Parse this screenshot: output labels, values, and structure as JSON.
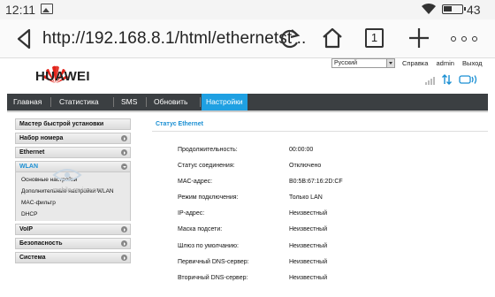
{
  "status_bar": {
    "time": "12:11",
    "battery_level": "43"
  },
  "browser": {
    "url": "http://192.168.8.1/html/ethernetst ..",
    "tab_count": "1"
  },
  "header": {
    "brand": "HUAWEI",
    "language": "Русский",
    "help_link": "Справка",
    "user_link": "admin",
    "logout_link": "Выход"
  },
  "nav": {
    "items": [
      {
        "label": "Главная"
      },
      {
        "label": "Статистика"
      },
      {
        "label": "SMS"
      },
      {
        "label": "Обновить"
      },
      {
        "label": "Настройки"
      }
    ]
  },
  "sidebar": {
    "quick_setup": "Мастер быстрой установки",
    "dialup": "Набор номера",
    "ethernet": "Ethernet",
    "wlan": "WLAN",
    "wlan_sub": [
      "Основные настройки",
      "Дополнительные настройки WLAN",
      "MAC-фильтр",
      "DHCP"
    ],
    "voip": "VoIP",
    "security": "Безопасность",
    "system": "Система"
  },
  "watermark_text": "mobile-review.com",
  "content": {
    "title": "Статус Ethernet",
    "rows": [
      {
        "label": "Продолжительность:",
        "value": "00:00:00"
      },
      {
        "label": "Статус соединения:",
        "value": "Отключено"
      },
      {
        "label": "MAC-адрес:",
        "value": "B0:5B:67:16:2D:CF"
      },
      {
        "label": "Режим подключения:",
        "value": "Только LAN"
      },
      {
        "label": "IP-адрес:",
        "value": "Неизвестный"
      },
      {
        "label": "Маска подсети:",
        "value": "Неизвестный"
      },
      {
        "label": "Шлюз по умолчанию:",
        "value": "Неизвестный"
      },
      {
        "label": "Первичный DNS-сервер:",
        "value": "Неизвестный"
      },
      {
        "label": "Вторичный DNS-сервер:",
        "value": "Неизвестный"
      }
    ]
  },
  "colors": {
    "accent": "#1fa0e2",
    "nav_bg": "#3b3f42",
    "brand_red": "#e2231a"
  }
}
